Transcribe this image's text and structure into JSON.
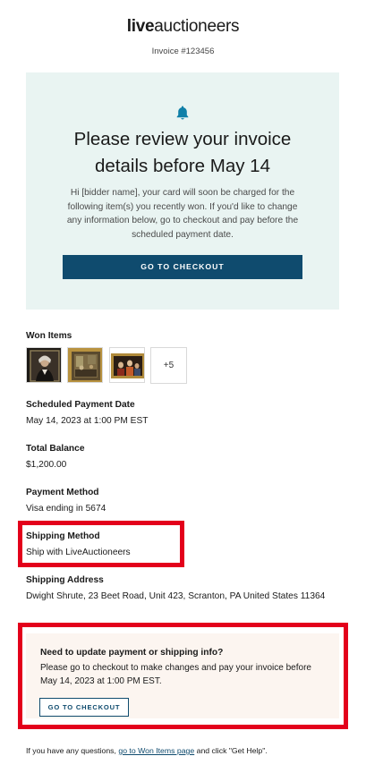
{
  "header": {
    "logo_bold": "live",
    "logo_rest": "auctioneers",
    "invoice_number": "Invoice #123456"
  },
  "hero": {
    "icon": "bell-icon",
    "title_line1": "Please review your invoice",
    "title_line2": "details before May 14",
    "message": "Hi [bidder name], your card will soon be charged for the following item(s) you recently won. If you'd like to change any information below, go to checkout and pay before the scheduled payment date.",
    "button_label": "GO TO CHECKOUT"
  },
  "won_items": {
    "label": "Won Items",
    "more_count": "+5"
  },
  "scheduled_payment": {
    "label": "Scheduled Payment Date",
    "value": "May 14, 2023 at 1:00 PM EST"
  },
  "total_balance": {
    "label": "Total Balance",
    "value": "$1,200.00"
  },
  "payment_method": {
    "label": "Payment Method",
    "value": "Visa ending in 5674"
  },
  "shipping_method": {
    "label": "Shipping Method",
    "value": "Ship with LiveAuctioneers"
  },
  "shipping_address": {
    "label": "Shipping Address",
    "value": "Dwight Shrute, 23 Beet Road, Unit 423, Scranton, PA United States 11364"
  },
  "notice": {
    "title": "Need to update payment or shipping info?",
    "text": "Please go to checkout to make changes and pay your invoice before May 14, 2023 at 1:00 PM EST.",
    "button_label": "GO TO CHECKOUT"
  },
  "footer": {
    "prefix": "If you have any questions, ",
    "link": "go to Won Items page",
    "suffix": " and click \"Get Help\"."
  },
  "colors": {
    "accent": "#0f4b6e",
    "hero_bg": "#e9f4f2",
    "notice_bg": "#fcf5f0",
    "highlight": "#e3001b",
    "bell": "#0f7fa8"
  }
}
